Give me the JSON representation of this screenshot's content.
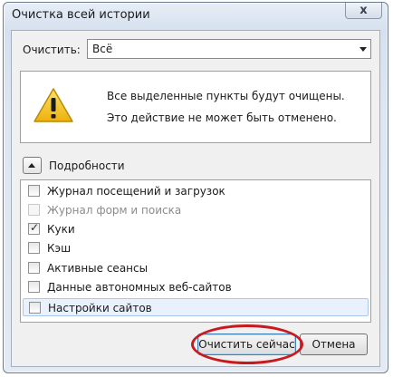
{
  "window": {
    "title": "Очистка всей истории",
    "close_glyph": "x"
  },
  "clear": {
    "label": "Очистить:",
    "selected_option": "Всё"
  },
  "warning": {
    "icon": "warning-icon",
    "line1": "Все выделенные пункты будут очищены.",
    "line2": "Это действие не может быть отменено."
  },
  "details": {
    "label": "Подробности",
    "expanded": true
  },
  "items": [
    {
      "label": "Журнал посещений и загрузок",
      "checked": false,
      "enabled": true
    },
    {
      "label": "Журнал форм и поиска",
      "checked": false,
      "enabled": false
    },
    {
      "label": "Куки",
      "checked": true,
      "enabled": true
    },
    {
      "label": "Кэш",
      "checked": false,
      "enabled": true
    },
    {
      "label": "Активные сеансы",
      "checked": false,
      "enabled": true
    },
    {
      "label": "Данные автономных веб-сайтов",
      "checked": false,
      "enabled": true
    },
    {
      "label": "Настройки сайтов",
      "checked": false,
      "enabled": true,
      "selected": true
    }
  ],
  "buttons": {
    "clear_now": "Очистить сейчас",
    "cancel": "Отмена"
  },
  "colors": {
    "highlight_ellipse": "#c8191e",
    "warning_yellow": "#f4c21b"
  }
}
